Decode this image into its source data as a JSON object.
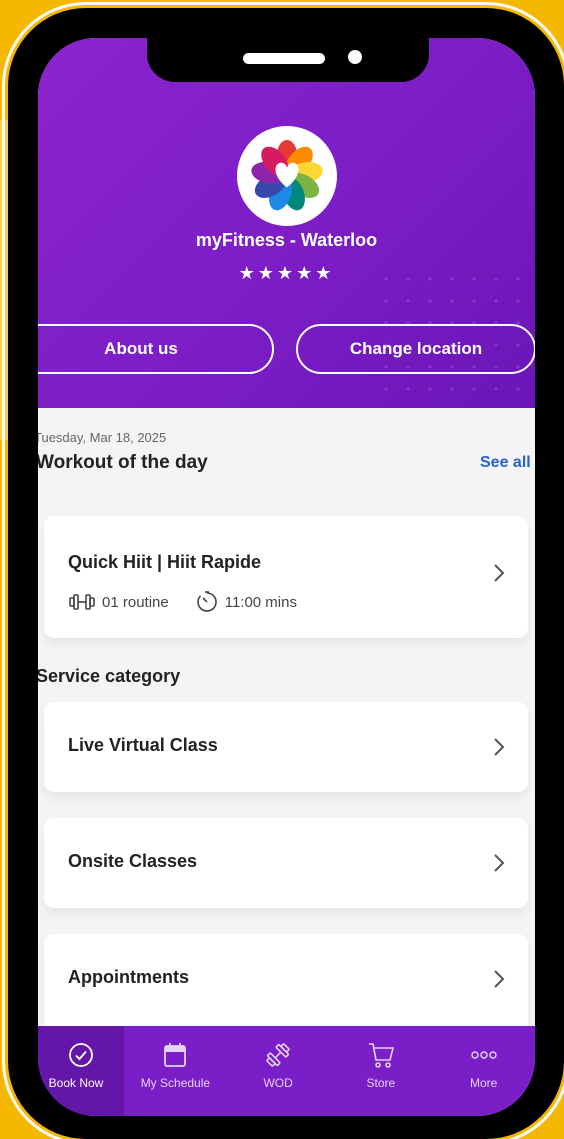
{
  "header": {
    "gym_name": "myFitness - Waterloo",
    "rating_stars": "★★★★★",
    "about_label": "About us",
    "change_location_label": "Change location"
  },
  "wod": {
    "date": "Tuesday, Mar 18, 2025",
    "title": "Workout of the day",
    "see_all": "See all",
    "card": {
      "title": "Quick Hiit | Hiit Rapide",
      "routine": "01 routine",
      "duration": "11:00 mins"
    }
  },
  "service": {
    "title": "Service category",
    "items": [
      {
        "label": "Live Virtual Class"
      },
      {
        "label": "Onsite Classes"
      },
      {
        "label": "Appointments"
      }
    ]
  },
  "tabbar": {
    "items": [
      {
        "label": "Book Now",
        "icon": "check-circle-icon",
        "active": true
      },
      {
        "label": "My Schedule",
        "icon": "calendar-icon"
      },
      {
        "label": "WOD",
        "icon": "dumbbell-icon"
      },
      {
        "label": "Store",
        "icon": "cart-icon"
      },
      {
        "label": "More",
        "icon": "more-dots-icon"
      }
    ]
  },
  "colors": {
    "brand_purple": "#7c1dc6",
    "link_blue": "#2a63c6",
    "frame_yellow": "#f5b800"
  }
}
